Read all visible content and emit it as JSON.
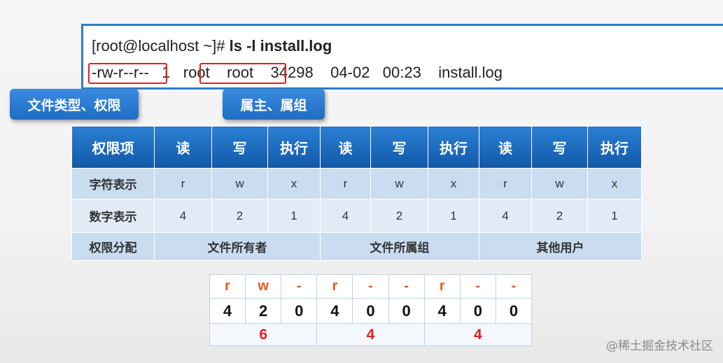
{
  "terminal": {
    "prompt": "[root@localhost ~]# ",
    "command": "ls -l install.log",
    "perms": "-rw-r--r--",
    "links": "1",
    "owner": "root",
    "group": "root",
    "size": "34298",
    "date": "04-02",
    "time": "00:23",
    "filename": "install.log"
  },
  "callouts": {
    "type_perm": "文件类型、权限",
    "owner_group": "属主、属组"
  },
  "perm_table": {
    "header": [
      "权限项",
      "读",
      "写",
      "执行",
      "读",
      "写",
      "执行",
      "读",
      "写",
      "执行"
    ],
    "char_row": [
      "字符表示",
      "r",
      "w",
      "x",
      "r",
      "w",
      "x",
      "r",
      "w",
      "x"
    ],
    "num_row": [
      "数字表示",
      "4",
      "2",
      "1",
      "4",
      "2",
      "1",
      "4",
      "2",
      "1"
    ],
    "assign_row": {
      "label": "权限分配",
      "owner": "文件所有者",
      "group": "文件所属组",
      "other": "其他用户"
    }
  },
  "calc_table": {
    "chars": [
      "r",
      "w",
      "-",
      "r",
      "-",
      "-",
      "r",
      "-",
      "-"
    ],
    "digits": [
      "4",
      "2",
      "0",
      "4",
      "0",
      "0",
      "4",
      "0",
      "0"
    ],
    "sums": [
      "6",
      "4",
      "4"
    ]
  },
  "watermark": "@稀土掘金技术社区",
  "colors": {
    "accent_blue": "#2f7dc5",
    "highlight_red": "#e02020",
    "char_orange": "#e8571c"
  }
}
